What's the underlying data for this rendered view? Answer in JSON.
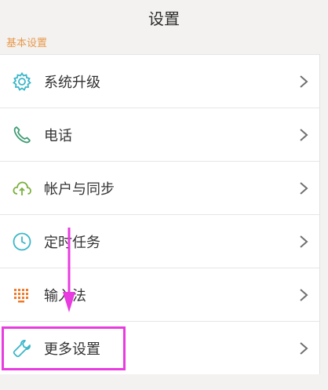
{
  "header": {
    "title": "设置"
  },
  "section": {
    "label": "基本设置"
  },
  "items": [
    {
      "label": "系统升级"
    },
    {
      "label": "电话"
    },
    {
      "label": "帐户与同步"
    },
    {
      "label": "定时任务"
    },
    {
      "label": "输入法"
    },
    {
      "label": "更多设置"
    }
  ],
  "colors": {
    "section_text": "#e8994a",
    "icon_teal": "#3bb6c9",
    "icon_green": "#3c9b73",
    "icon_lime": "#7ab03d",
    "icon_orange": "#f07a2a",
    "annotation": "#e83be0",
    "chevron": "#707070"
  },
  "icons": [
    "gear-icon",
    "phone-icon",
    "cloud-sync-icon",
    "clock-icon",
    "keyboard-icon",
    "wrench-icon",
    "chevron-right-icon"
  ]
}
